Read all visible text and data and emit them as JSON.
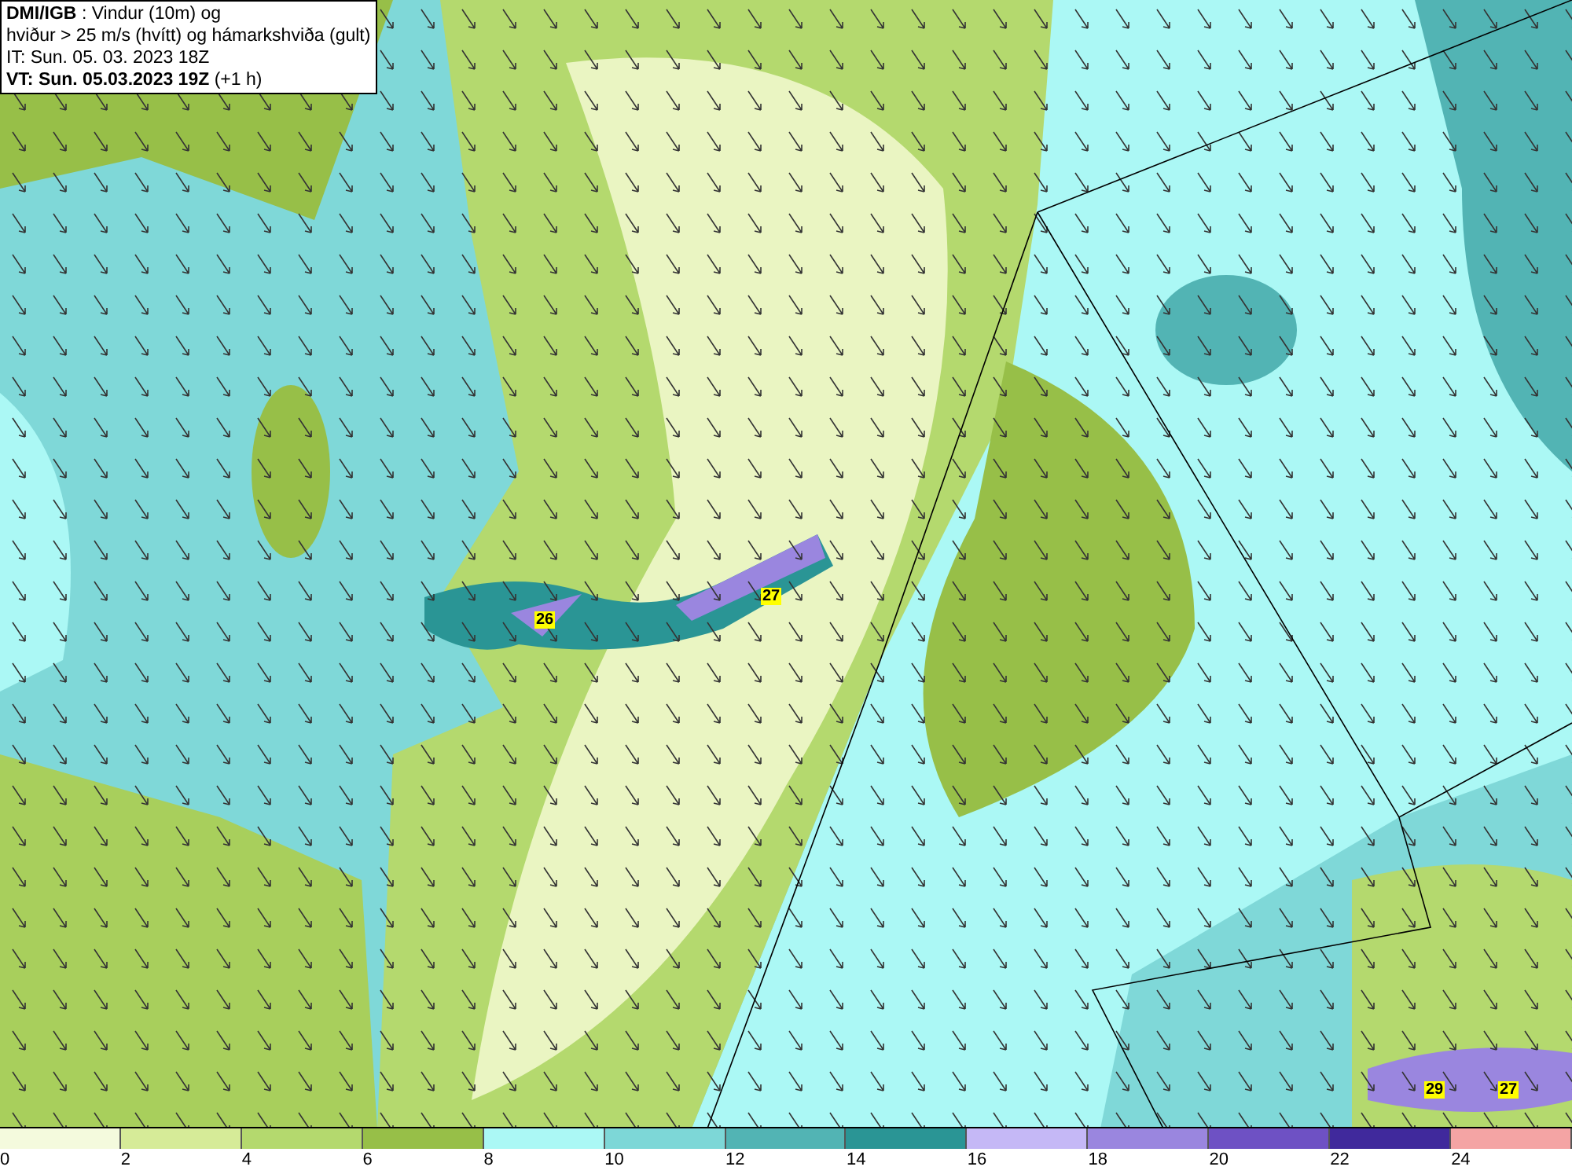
{
  "header": {
    "title_bold": "DMI/IGB",
    "title_rest": ": Vindur (10m) og",
    "line2": "hviður > 25 m/s (hvítt) og hámarkshviða (gult)",
    "issue_time": "IT: Sun. 05. 03. 2023 18Z",
    "valid_time_bold": "VT: Sun. 05.03.2023 19Z",
    "valid_time_rest": "(+1 h)"
  },
  "gust_labels": [
    {
      "value": "26"
    },
    {
      "value": "27"
    },
    {
      "value": "29"
    },
    {
      "value": "27"
    }
  ],
  "legend": [
    {
      "label": "0",
      "color": "#f4fadd"
    },
    {
      "label": "2",
      "color": "#d6eb98"
    },
    {
      "label": "4",
      "color": "#b4d96e"
    },
    {
      "label": "6",
      "color": "#97bf48"
    },
    {
      "label": "8",
      "color": "#abf8f5"
    },
    {
      "label": "10",
      "color": "#7dd7d7"
    },
    {
      "label": "12",
      "color": "#52b4b4"
    },
    {
      "label": "14",
      "color": "#2a9595"
    },
    {
      "label": "16",
      "color": "#c5b8f6"
    },
    {
      "label": "18",
      "color": "#9a86df"
    },
    {
      "label": "20",
      "color": "#6e51c4"
    },
    {
      "label": "22",
      "color": "#40299c"
    },
    {
      "label": "24",
      "color": "#f4a4a4"
    }
  ]
}
